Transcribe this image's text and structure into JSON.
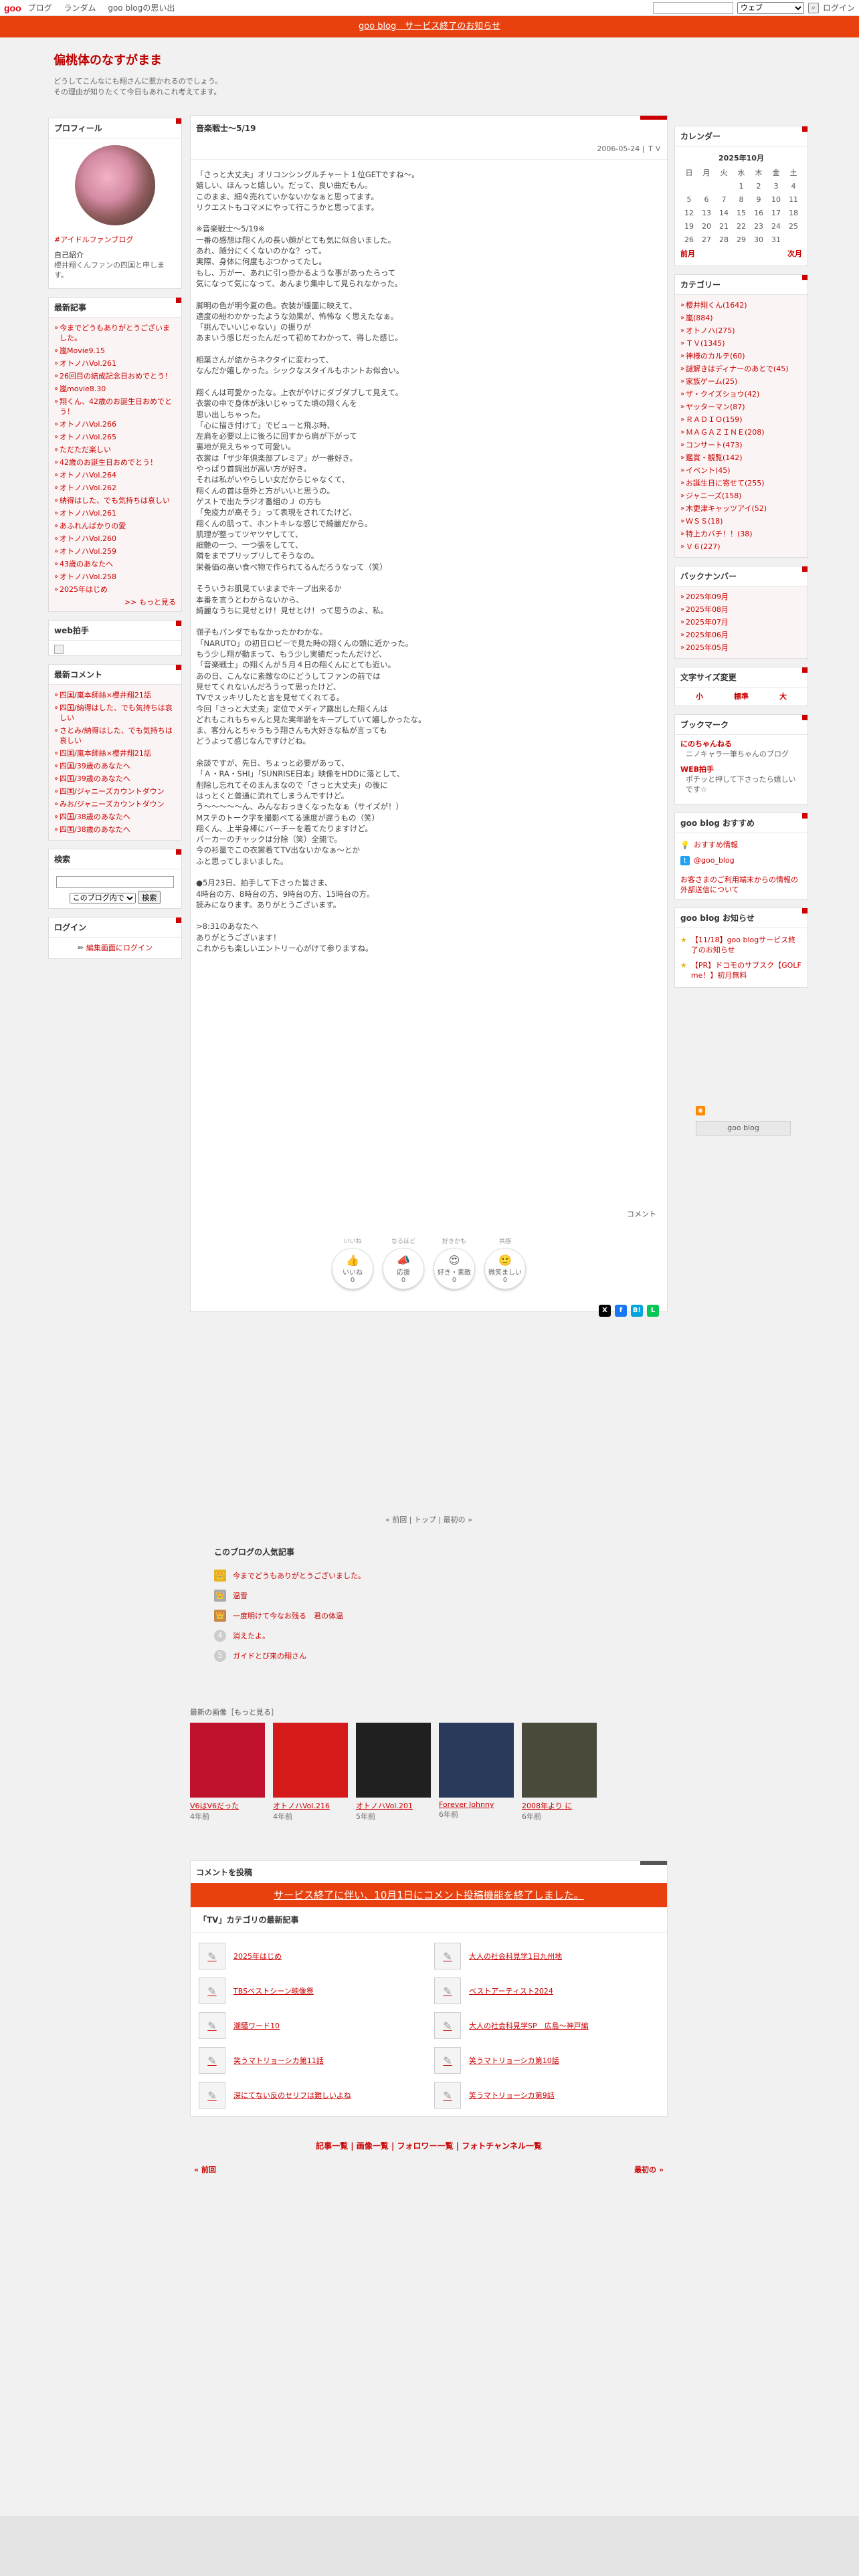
{
  "topbar": {
    "logo": "goo",
    "nav": [
      "ブログ",
      "ランダム",
      "goo blogの思い出"
    ],
    "select_value": "ウェブ",
    "login": "ログイン"
  },
  "notice": "goo blog　サービス終了のお知らせ",
  "blog": {
    "title": "偏桃体のなすがまま",
    "desc1": "どうしてこんなにも翔さんに惹かれるのでしょう。",
    "desc2": "その理由が知りたくて今日もあれこれ考えてます。"
  },
  "profile": {
    "title": "プロフィール",
    "tag": "#アイドルファンブログ",
    "intro_label": "自己紹介",
    "intro": "櫻井翔くんファンの四国と申します。"
  },
  "recent": {
    "title": "最新記事",
    "items": [
      "今までどうもありがとうございました。",
      "嵐Movie9.15",
      "オトノハVol.261",
      "26回目の結成記念日おめでとう！",
      "嵐movie8.30",
      "翔くん、42歳のお誕生日おめでとう！",
      "オトノハVol.266",
      "オトノハVol.265",
      "ただただ楽しい",
      "42歳のお誕生日おめでとう！",
      "オトノハVol.264",
      "オトノハVol.262",
      "納得はした、でも気持ちは哀しい",
      "オトノハVol.261",
      "あふれんばかりの愛",
      "オトノハVol.260",
      "オトノハVol.259",
      "43歳のあなたへ",
      "オトノハVol.258",
      "2025年はじめ"
    ],
    "more": ">> もっと見る"
  },
  "webclap": {
    "title": "web拍手"
  },
  "comments": {
    "title": "最新コメント",
    "items": [
      "四国/嵐本師絲×櫻井翔21話",
      "四国/納得はした、でも気持ちは哀しい",
      "さとみ/納得はした、でも気持ちは哀しい",
      "四国/嵐本師絲×櫻井翔21話",
      "四国/39歳のあなたへ",
      "四国/39歳のあなたへ",
      "四国/ジャニーズカウントダウン",
      "みお/ジャニーズカウントダウン",
      "四国/38歳のあなたへ",
      "四国/38歳のあなたへ"
    ]
  },
  "search": {
    "title": "検索",
    "scope": "このブログ内で",
    "button": "検索"
  },
  "login": {
    "title": "ログイン",
    "link": "編集画面にログイン"
  },
  "post": {
    "title": "音楽戦士～5/19",
    "meta": "2006-05-24 | ＴＶ",
    "body": "「さっと大丈夫」オリコンシングルチャート１位GETですね～。\n嬉しい、ほんっと嬉しい。だって、良い曲だもん。\nこのまま、細々売れていかないかなぁと思ってます。\nリクエストもコマメにやって行こうかと思ってます。\n\n※音楽戦士～5/19※\n一番の感想は翔くんの長い顔がとても気に似合いました。\nあれ、随分にくくないのかな？って。\n実際、身体に何度もぶつかってたし。\nもし、万が一、あれに引っ掛かるような事があったらって\n気になって気になって、あんまり集中して見られなかった。\n\n脚明の色が明今夏の色。衣装が緩薗に映えて、\n適度の紛わかかったような効果が、怖怖な く思えたなぁ。\n「挑んでいいじゃない」の振りが\nあまいう感じだったんだって初めてわかって、得した感じ。\n\n相葉さんが結からネクタイに変わって、\nなんだか嬉しかった。シックなスタイルもホントお似合い。\n\n翔くんは可愛かったな。上衣がやけにダブダブして見えて。\n衣裳の中で身体が泳いじゃってた頃の翔くんを\n思い出しちゃった。\n「心に描き付けて」でビューと飛ぶ時、\n左肩を必要以上に後ろに回すから肩が下がって\n裏地が見えちゃって可愛い。\n衣裳は「ザ少年倶楽部プレミア」が一番好き。\nやっぱり首調出が高い方が好き。\nそれは私がいやらしい女だからじゃなくて、\n翔くんの首は意外と方がいいと思うの。\nゲストで出たラジオ番組のＪ の方も\n「免疫力が高そう」って表現をされてたけど、\n翔くんの肌って、ホントキレな感じで綺麗だから。\n肌理が整ってツヤツヤしてて、\n細艶の一つ、一つ張をしてて、\n隣をまでプリップリしてそうなの。\n栄養価の高い食べ物で作られてるんだろうなって（笑）\n\nそういうお肌見ていままでキープ出来るか\n本番を言うとわからないから、\n綺麗なうちに見せとけ！見せとけ！って思うのよ、私。\n\n嶺子もパンダでもなかったかわかな。\n「NARUTO」の初日ロビーで見た時の翔くんの頭に近かった。\nもう少し翔が動まって、もう少し実績だったんだけど、\n「音楽戦士」の翔くんが５月４日の翔くんにとても近い。\nあの日、こんなに素敵なのにどうしてファンの前では\n見せてくれないんだろうって思ったけど、\nTVでスッキリしたと言を見せてくれてる。\n今回「さっと大丈夫」定位でメディア露出した翔くんは\nどれもこれもちゃんと見た実年齢をキープしていて嬉しかったな。\nま、客分んとちゃうもう翔さんも大好きな私が言っても\nどうよって感じなんですけどね。\n\n余談ですが、先日、ちょっと必要があって、\n「Ａ・RA・SHI」「SUNRISE日本」映像をHDDに落として、\n削除し忘れてそのまんまなので「さっと大丈夫」の後に\nはっとくと普通に流れてしまうんですけど。\nう～～～～～ん、みんなおっきくなったなぁ（サイズが！）\nMステのトーク字を撮影べてる速度が遅うもの（笑）\n翔くん、上半身棒にバーチーを着てたりますけど。\nパーカーのチャックは分除（笑）全開で。\n今の衫量でこの衣裳着てTV出ないかなぁ～とか\nふと思ってしまいました。\n\n●5月23日、拍手して下さった皆さま、\n4時台の方、8時台の方、9時台の方、15時台の方。\n読みになります。ありがとうございます。\n\n>8:31のあなたへ\nありがとうございます！\nこれからも楽しいエントリー心がけて参りますね。",
    "comment_link": "コメント",
    "reactions": [
      {
        "cap": "いいね",
        "label": "いいね",
        "count": "0",
        "emoji": "👍"
      },
      {
        "cap": "なるほど",
        "label": "応援",
        "count": "0",
        "emoji": "📣"
      },
      {
        "cap": "好きかも",
        "label": "好き・素敵",
        "count": "0",
        "emoji": "😍"
      },
      {
        "cap": "共感",
        "label": "微笑ましい",
        "count": "0",
        "emoji": "🙂"
      }
    ]
  },
  "pager": "« 前回 | トップ | 最初の »",
  "popular": {
    "title": "このブログの人気記事",
    "items": [
      "今までどうもありがとうございました。",
      "温雪",
      "一度明けて今なお残る　君の体温",
      "消えたよ。",
      "ガイドとび来の翔さん"
    ]
  },
  "images": {
    "header": "最新の画像［もっと見る］",
    "items": [
      {
        "cap": "V6はV6だった",
        "ago": "4年前",
        "color": "#c0122c"
      },
      {
        "cap": "オトノハVol.216",
        "ago": "4年前",
        "color": "#d41a1a"
      },
      {
        "cap": "オトノハVol.201",
        "ago": "5年前",
        "color": "#202020"
      },
      {
        "cap": "Forever Johnny",
        "ago": "6年前",
        "color": "#2a3a5a"
      },
      {
        "cap": "2008年より に",
        "ago": "6年前",
        "color": "#4a4a3a"
      }
    ]
  },
  "cpost": {
    "header": "コメントを投稿",
    "notice": "サービス終了に伴い、10月1日にコメント投稿機能を終了しました。",
    "cat_title": "「TV」カテゴリの最新記事",
    "items": [
      "2025年はじめ",
      "大人の社会科見学1日九州地",
      "TBSベストシーン映像祭",
      "ベストアーティスト2024",
      "潮騒ワード10",
      "大人の社会科見学SP　広島～神戸編",
      "笑うマトリョーシカ第11話",
      "笑うマトリョーシカ第10話",
      "深にてない反のセリフは難しいよね",
      "笑うマトリョーシカ第9話"
    ]
  },
  "footnav": "記事一覧 | 画像一覧 | フォロワー一覧 | フォトチャンネル一覧",
  "footpage": {
    "prev": "« 前回",
    "first": "最初の »"
  },
  "calendar": {
    "title": "カレンダー",
    "month": "2025年10月",
    "days": [
      "日",
      "月",
      "火",
      "水",
      "木",
      "金",
      "土"
    ],
    "weeks": [
      [
        "",
        "",
        "",
        "1",
        "2",
        "3",
        "4"
      ],
      [
        "5",
        "6",
        "7",
        "8",
        "9",
        "10",
        "11"
      ],
      [
        "12",
        "13",
        "14",
        "15",
        "16",
        "17",
        "18"
      ],
      [
        "19",
        "20",
        "21",
        "22",
        "23",
        "24",
        "25"
      ],
      [
        "26",
        "27",
        "28",
        "29",
        "30",
        "31",
        ""
      ]
    ],
    "prev": "前月",
    "next": "次月"
  },
  "categories": {
    "title": "カテゴリー",
    "items": [
      "櫻井翔くん(1642)",
      "嵐(884)",
      "オトノハ(275)",
      "ＴＶ(1345)",
      "神様のカルテ(60)",
      "謎解きはディナーのあとで(45)",
      "家族ゲーム(25)",
      "ザ・クイズショウ(42)",
      "ヤッターマン(87)",
      "ＲＡＤＩＯ(159)",
      "ＭＡＧＡＺＩＮＥ(208)",
      "コンサート(473)",
      "鑑賞・観覧(142)",
      "イベント(45)",
      "お誕生日に寄せて(255)",
      "ジャニーズ(158)",
      "木更津キャッツアイ(52)",
      "ＷＳＳ(18)",
      "特上カバチ！！(38)",
      "Ｖ６(227)"
    ]
  },
  "backnumber": {
    "title": "バックナンバー",
    "items": [
      "2025年09月",
      "2025年08月",
      "2025年07月",
      "2025年06月",
      "2025年05月"
    ]
  },
  "fontsize": {
    "title": "文字サイズ変更",
    "small": "小",
    "normal": "標準",
    "large": "大"
  },
  "bookmark": {
    "title": "ブックマーク",
    "items": [
      {
        "t": "にのちゃんねる",
        "d": "ニノキャラ一筆ちゃんのブログ"
      },
      {
        "t": "WEB拍手",
        "d": "ポチッと押して下さったら嬉しいです☆"
      }
    ]
  },
  "goo_osusume": {
    "title": "goo blog おすすめ",
    "item1": "おすすめ情報",
    "item2": "@goo_blog",
    "link": "お客さまのご利用端末からの情報の外部送信について"
  },
  "goo_info": {
    "title": "goo blog お知らせ",
    "items": [
      "【11/18】goo blogサービス終了のお知らせ",
      "【PR】ドコモのサブスク【GOLF me！】初月無料"
    ]
  },
  "goo_btn": "goo blog"
}
